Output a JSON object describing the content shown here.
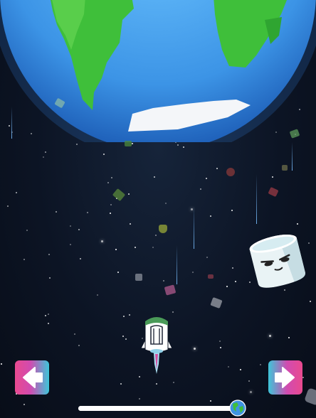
{
  "game": {
    "colors": {
      "space": "#0c1424",
      "ocean": "#4aa9ee",
      "land": "#3fbf3a",
      "ice": "#f4f6f9",
      "button_pink": "#e94a8f",
      "button_cyan": "#3dc6d9",
      "progress_bar": "#f3f5f8"
    },
    "icons": {
      "planet": "earth-planet",
      "player": "rocket-ship",
      "enemy": "marshmallow-character",
      "left_control": "left-arrow-icon",
      "right_control": "right-arrow-icon",
      "progress_marker": "earth-globe-icon"
    },
    "progress": {
      "fraction": 1.0
    },
    "controls": {
      "left": {
        "label": ""
      },
      "right": {
        "label": ""
      }
    }
  }
}
